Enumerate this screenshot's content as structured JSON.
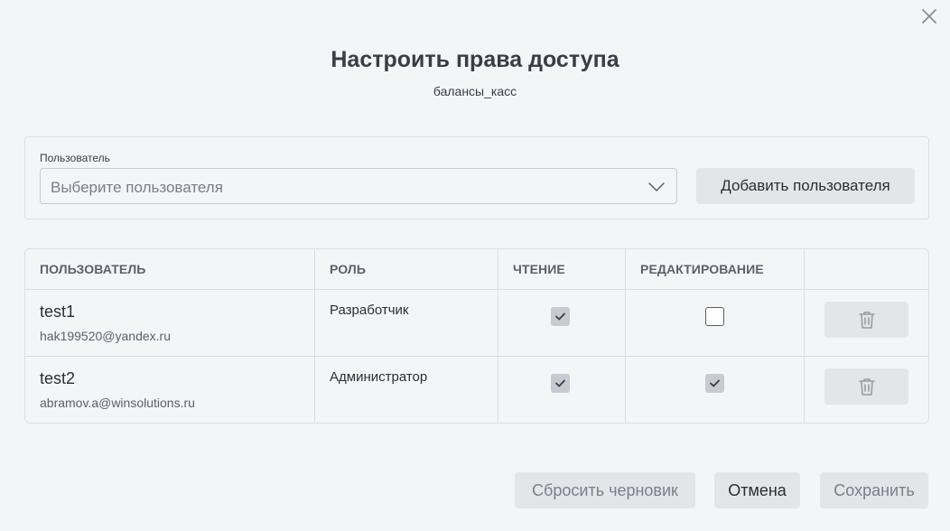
{
  "dialog": {
    "title": "Настроить права доступа",
    "subtitle": "балансы_касс",
    "close_icon": "close-icon"
  },
  "user_select": {
    "label": "Пользователь",
    "placeholder": "Выберите пользователя",
    "add_button": "Добавить пользователя"
  },
  "table": {
    "headers": {
      "user": "ПОЛЬЗОВАТЕЛЬ",
      "role": "РОЛЬ",
      "read": "ЧТЕНИЕ",
      "edit": "РЕДАКТИРОВАНИЕ"
    },
    "rows": [
      {
        "name": "test1",
        "email": "hak199520@yandex.ru",
        "role": "Разработчик",
        "read": true,
        "edit": false
      },
      {
        "name": "test2",
        "email": "abramov.a@winsolutions.ru",
        "role": "Администратор",
        "read": true,
        "edit": true
      }
    ]
  },
  "footer": {
    "reset_button": "Сбросить черновик",
    "cancel_button": "Отмена",
    "save_button": "Сохранить"
  },
  "colors": {
    "background": "#f4f5f7",
    "button_bg": "#e4e5e9",
    "checkbox_checked": "#c8cad0",
    "text_dark": "#2c2e36",
    "text_muted": "#7b7e89"
  }
}
